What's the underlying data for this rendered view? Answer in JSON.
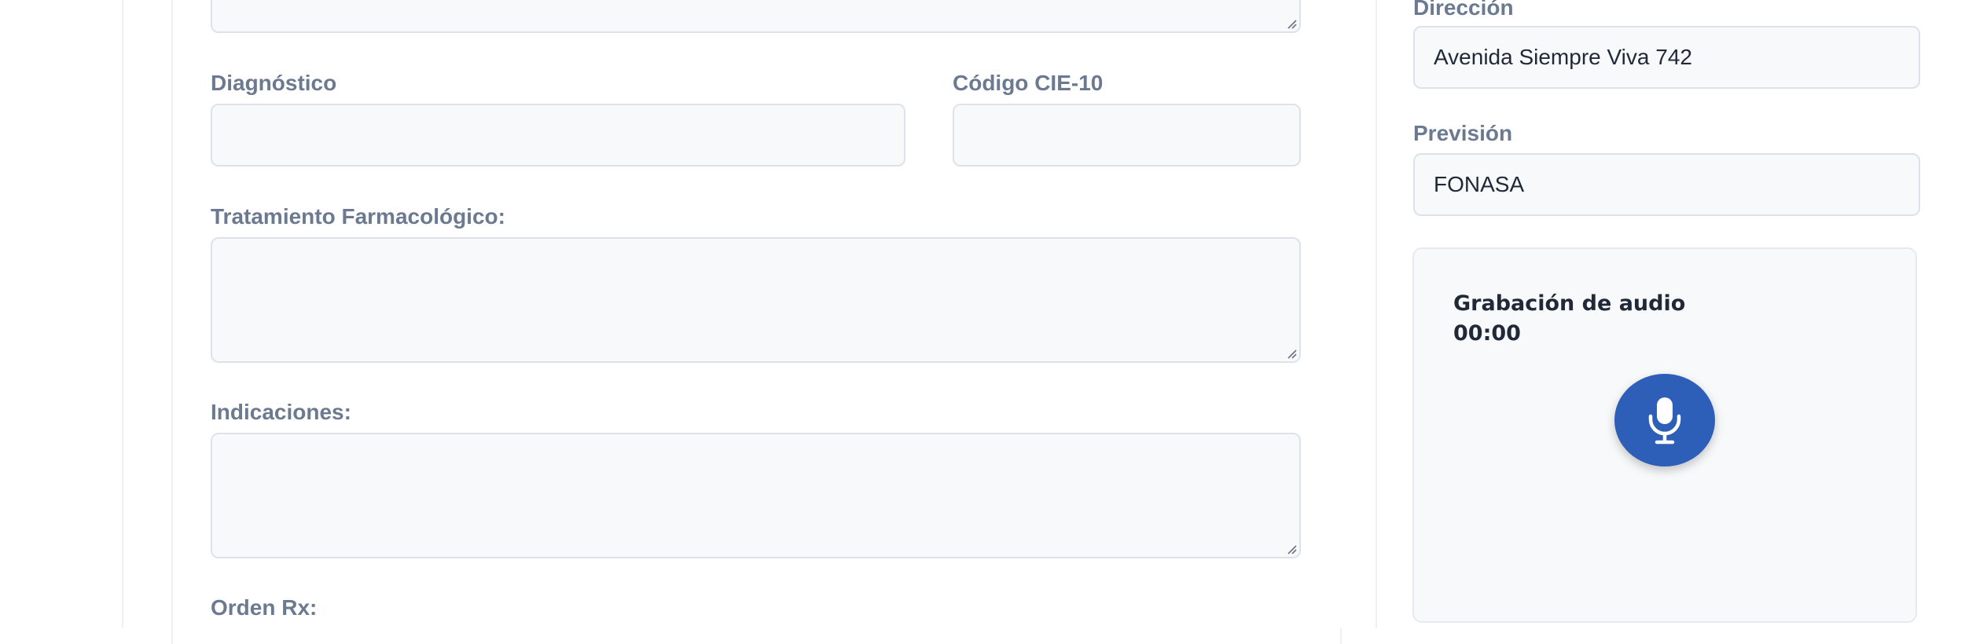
{
  "form": {
    "diagnostico": {
      "label": "Diagnóstico",
      "value": ""
    },
    "codigo_cie": {
      "label": "Código CIE-10",
      "value": ""
    },
    "tratamiento": {
      "label": "Tratamiento Farmacológico:",
      "value": ""
    },
    "indicaciones": {
      "label": "Indicaciones:",
      "value": ""
    },
    "orden_rx": {
      "label": "Orden Rx:"
    }
  },
  "patient": {
    "direccion": {
      "label": "Dirección",
      "value": "Avenida Siempre Viva 742"
    },
    "prevision": {
      "label": "Previsión",
      "value": "FONASA"
    }
  },
  "audio": {
    "title": "Grabación de audio",
    "timer": "00:00",
    "record_icon": "microphone-icon",
    "button_color": "#2e5fb8"
  }
}
